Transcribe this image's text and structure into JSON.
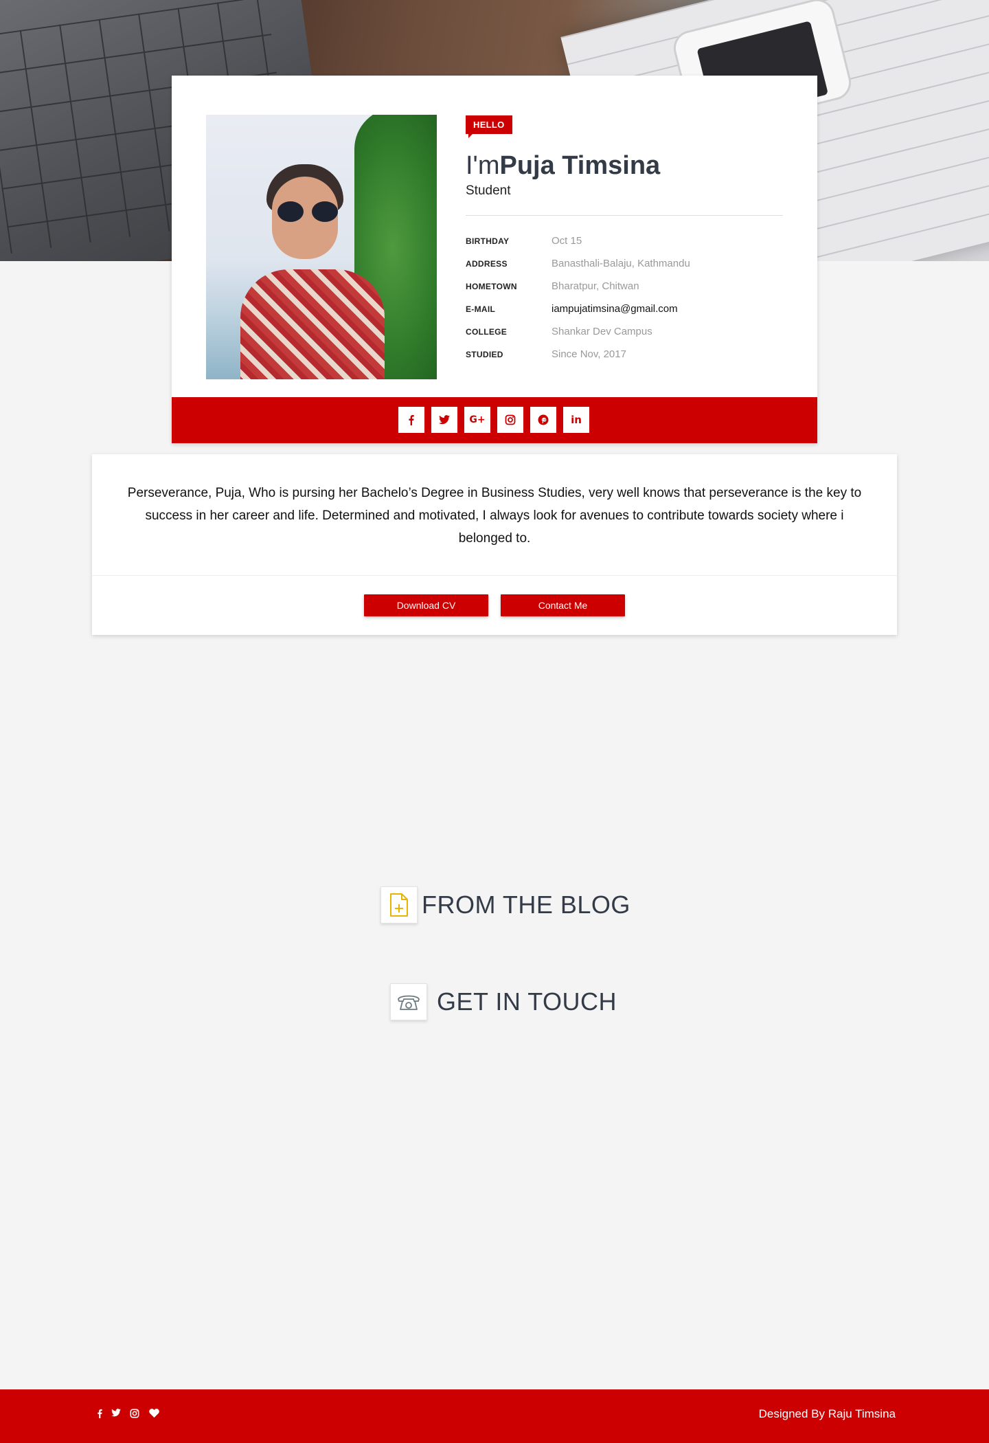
{
  "hero": {
    "alt": "desk with laptop and notes"
  },
  "profile": {
    "tag": "HELLO",
    "greeting": "I'm",
    "name": "Puja Timsina",
    "role": "Student",
    "details": [
      {
        "label": "BIRTHDAY",
        "value": "Oct 15"
      },
      {
        "label": "ADDRESS",
        "value": "Banasthali-Balaju, Kathmandu"
      },
      {
        "label": "HOMETOWN",
        "value": "Bharatpur, Chitwan"
      },
      {
        "label": "E-MAIL",
        "value": "iampujatimsina@gmail.com"
      },
      {
        "label": "COLLEGE",
        "value": "Shankar Dev Campus"
      },
      {
        "label": "STUDIED",
        "value": "Since Nov, 2017"
      }
    ],
    "social": [
      {
        "icon": "facebook-icon",
        "glyph": "f"
      },
      {
        "icon": "twitter-icon",
        "glyph": "🐦"
      },
      {
        "icon": "google-plus-icon",
        "glyph": "G+"
      },
      {
        "icon": "instagram-icon",
        "glyph": "◎"
      },
      {
        "icon": "pinterest-icon",
        "glyph": "℗"
      },
      {
        "icon": "linkedin-icon",
        "glyph": "in"
      }
    ]
  },
  "about": {
    "text": "Perseverance, Puja, Who is pursing her Bachelo’s Degree in Business Studies, very well knows that perseverance is the key to success in her career and life. Determined and motivated, I always look for avenues to contribute towards society where i belonged to.",
    "download_label": "Download CV",
    "contact_label": "Contact Me"
  },
  "sections": {
    "blog_title": "FROM THE BLOG",
    "contact_title": "GET IN TOUCH"
  },
  "footer": {
    "credit": "Designed By Raju Timsina",
    "icons": [
      "facebook-icon",
      "twitter-icon",
      "instagram-icon",
      "heart-icon"
    ]
  },
  "colors": {
    "accent": "#cc0000",
    "heading": "#333b47",
    "muted": "#999999",
    "background": "#f4f4f4"
  }
}
